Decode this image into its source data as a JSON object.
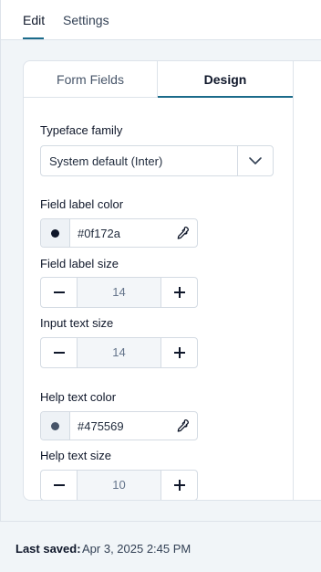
{
  "top_tabs": [
    {
      "label": "Edit",
      "active": true
    },
    {
      "label": "Settings",
      "active": false
    }
  ],
  "card_tabs": [
    {
      "label": "Form Fields",
      "active": false
    },
    {
      "label": "Design",
      "active": true
    }
  ],
  "typeface": {
    "label": "Typeface family",
    "value": "System default (Inter)",
    "icon": "chevron-down-icon"
  },
  "field_label_color": {
    "label": "Field label color",
    "value": "#0f172a",
    "swatch": "#0f172a",
    "icon": "eyedropper-icon"
  },
  "field_label_size": {
    "label": "Field label size",
    "value": "14"
  },
  "input_text_size": {
    "label": "Input text size",
    "value": "14"
  },
  "help_text_color": {
    "label": "Help text color",
    "value": "#475569",
    "swatch": "#475569",
    "icon": "eyedropper-icon"
  },
  "help_text_size": {
    "label": "Help text size",
    "value": "10"
  },
  "footer": {
    "label": "Last saved:",
    "value": "Apr 3, 2025 2:45 PM"
  },
  "colors": {
    "accent": "#1b6b8a",
    "text": "#0f172a",
    "border": "#d4dbe3",
    "background": "#f1f5f8"
  }
}
